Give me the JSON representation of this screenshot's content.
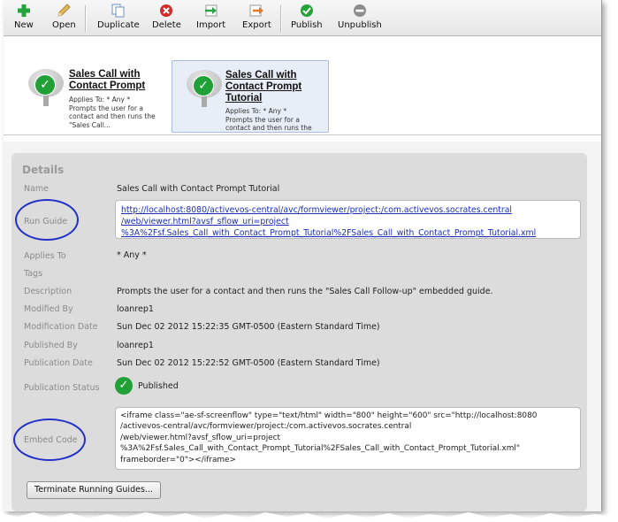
{
  "toolbar": {
    "buttons": [
      {
        "label": "New",
        "icon": "plus-icon",
        "color": "#23a33a"
      },
      {
        "label": "Open",
        "icon": "pencil-icon",
        "color": "#d9a441"
      },
      {
        "label": "Duplicate",
        "icon": "duplicate-icon",
        "color": "#6a8fc7"
      },
      {
        "label": "Delete",
        "icon": "delete-icon",
        "color": "#d42a2a"
      },
      {
        "label": "Import",
        "icon": "import-icon",
        "color": "#2fa04a"
      },
      {
        "label": "Export",
        "icon": "export-icon",
        "color": "#e07a2a"
      },
      {
        "label": "Publish",
        "icon": "publish-icon",
        "color": "#23a33a"
      },
      {
        "label": "Unpublish",
        "icon": "unpublish-icon",
        "color": "#8c8c8c"
      }
    ]
  },
  "gallery": {
    "cards": [
      {
        "title_line1": "Sales Call with",
        "title_line2": "Contact Prompt",
        "title_line3": "",
        "desc_lines": [
          "Applies To: * Any *",
          "Prompts the user for a",
          "contact and then runs the",
          "\"Sales Call..."
        ]
      },
      {
        "title_line1": "Sales Call with",
        "title_line2": "Contact Prompt",
        "title_line3": "Tutorial",
        "desc_lines": [
          "Applies To: * Any *",
          "Prompts the user for a",
          "contact and then runs the"
        ]
      }
    ]
  },
  "details": {
    "heading": "Details",
    "name_label": "Name",
    "name_value": "Sales Call with Contact Prompt Tutorial",
    "run_guide_label": "Run Guide",
    "run_guide_url_lines": [
      "http://localhost:8080/activevos-central/avc/formviewer/project:/com.activevos.socrates.central",
      "/web/viewer.html?avsf_sflow_uri=project",
      "%3A%2Fsf.Sales_Call_with_Contact_Prompt_Tutorial%2FSales_Call_with_Contact_Prompt_Tutorial.xml"
    ],
    "applies_to_label": "Applies To",
    "applies_to_value": "* Any *",
    "tags_label": "Tags",
    "description_label": "Description",
    "description_value": "Prompts the user for a contact and then runs the \"Sales Call Follow-up\" embedded guide.",
    "modified_by_label": "Modified By",
    "modified_by_value": "loanrep1",
    "modification_date_label": "Modification Date",
    "modification_date_value": "Sun Dec 02 2012 15:22:35 GMT-0500 (Eastern Standard Time)",
    "published_by_label": "Published By",
    "published_by_value": "loanrep1",
    "publication_date_label": "Publication Date",
    "publication_date_value": "Sun Dec 02 2012 15:22:52 GMT-0500 (Eastern Standard Time)",
    "publication_status_label": "Publication Status",
    "publication_status_value": "Published",
    "embed_code_label": "Embed Code",
    "embed_code_lines": [
      "<iframe class=\"ae-sf-screenflow\" type=\"text/html\" width=\"800\" height=\"600\" src=\"http://localhost:8080",
      "/activevos-central/avc/formviewer/project:/com.activevos.socrates.central",
      "/web/viewer.html?avsf_sflow_uri=project",
      "%3A%2Fsf.Sales_Call_with_Contact_Prompt_Tutorial%2FSales_Call_with_Contact_Prompt_Tutorial.xml\"",
      "frameborder=\"0\"></iframe>"
    ],
    "terminate_button_label": "Terminate Running Guides..."
  },
  "colors": {
    "check_green": "#21a038",
    "highlight_oval": "#2230c9",
    "link_blue": "#1a2fb5"
  }
}
